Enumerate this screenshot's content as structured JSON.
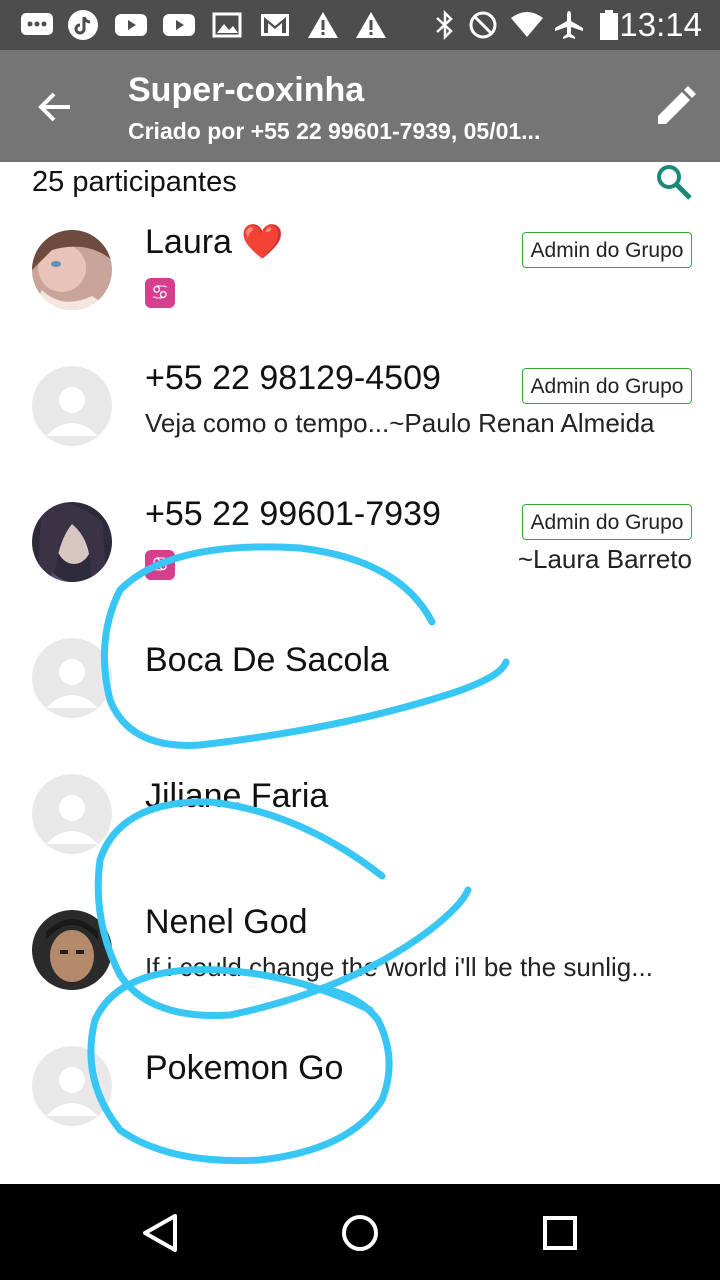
{
  "status_bar": {
    "time": "13:14",
    "left_icons": [
      "message-icon",
      "tiktok-icon",
      "youtube-icon",
      "youtube-icon",
      "gallery-icon",
      "gmail-icon",
      "warning-icon",
      "warning-icon"
    ],
    "right_icons": [
      "bluetooth-icon",
      "do-not-disturb-icon",
      "wifi-icon",
      "airplane-icon",
      "battery-icon"
    ]
  },
  "header": {
    "title": "Super-coxinha",
    "subtitle": "Criado por +55 22 99601-7939, 05/01..."
  },
  "participants": {
    "count_label": "25 participantes",
    "list": [
      {
        "name": "Laura ❤️",
        "status": "",
        "admin_label": "Admin do Grupo",
        "sign": "♋",
        "status_right": ""
      },
      {
        "name": "+55 22 98129-4509",
        "status": "Veja como o tempo...~Paulo Renan Almeida",
        "admin_label": "Admin do Grupo",
        "sign": "",
        "status_right": ""
      },
      {
        "name": "+55 22 99601-7939",
        "status": "",
        "admin_label": "Admin do Grupo",
        "sign": "♋",
        "status_right": "~Laura Barreto"
      },
      {
        "name": "Boca De Sacola",
        "status": "",
        "admin_label": "",
        "sign": "",
        "status_right": ""
      },
      {
        "name": "Jiliane Faria",
        "status": "",
        "admin_label": "",
        "sign": "",
        "status_right": ""
      },
      {
        "name": "Nenel God",
        "status": "If i could change the world i'll be the sunlig...",
        "admin_label": "",
        "sign": "",
        "status_right": ""
      },
      {
        "name": "Pokemon Go",
        "status": "",
        "admin_label": "",
        "sign": "",
        "status_right": ""
      }
    ]
  },
  "colors": {
    "status_bar": "#4d4d4d",
    "app_bar": "#757575",
    "accent": "#1a8a7a",
    "admin_border": "#3aa63a",
    "annotation_stroke": "#38c6f4"
  }
}
